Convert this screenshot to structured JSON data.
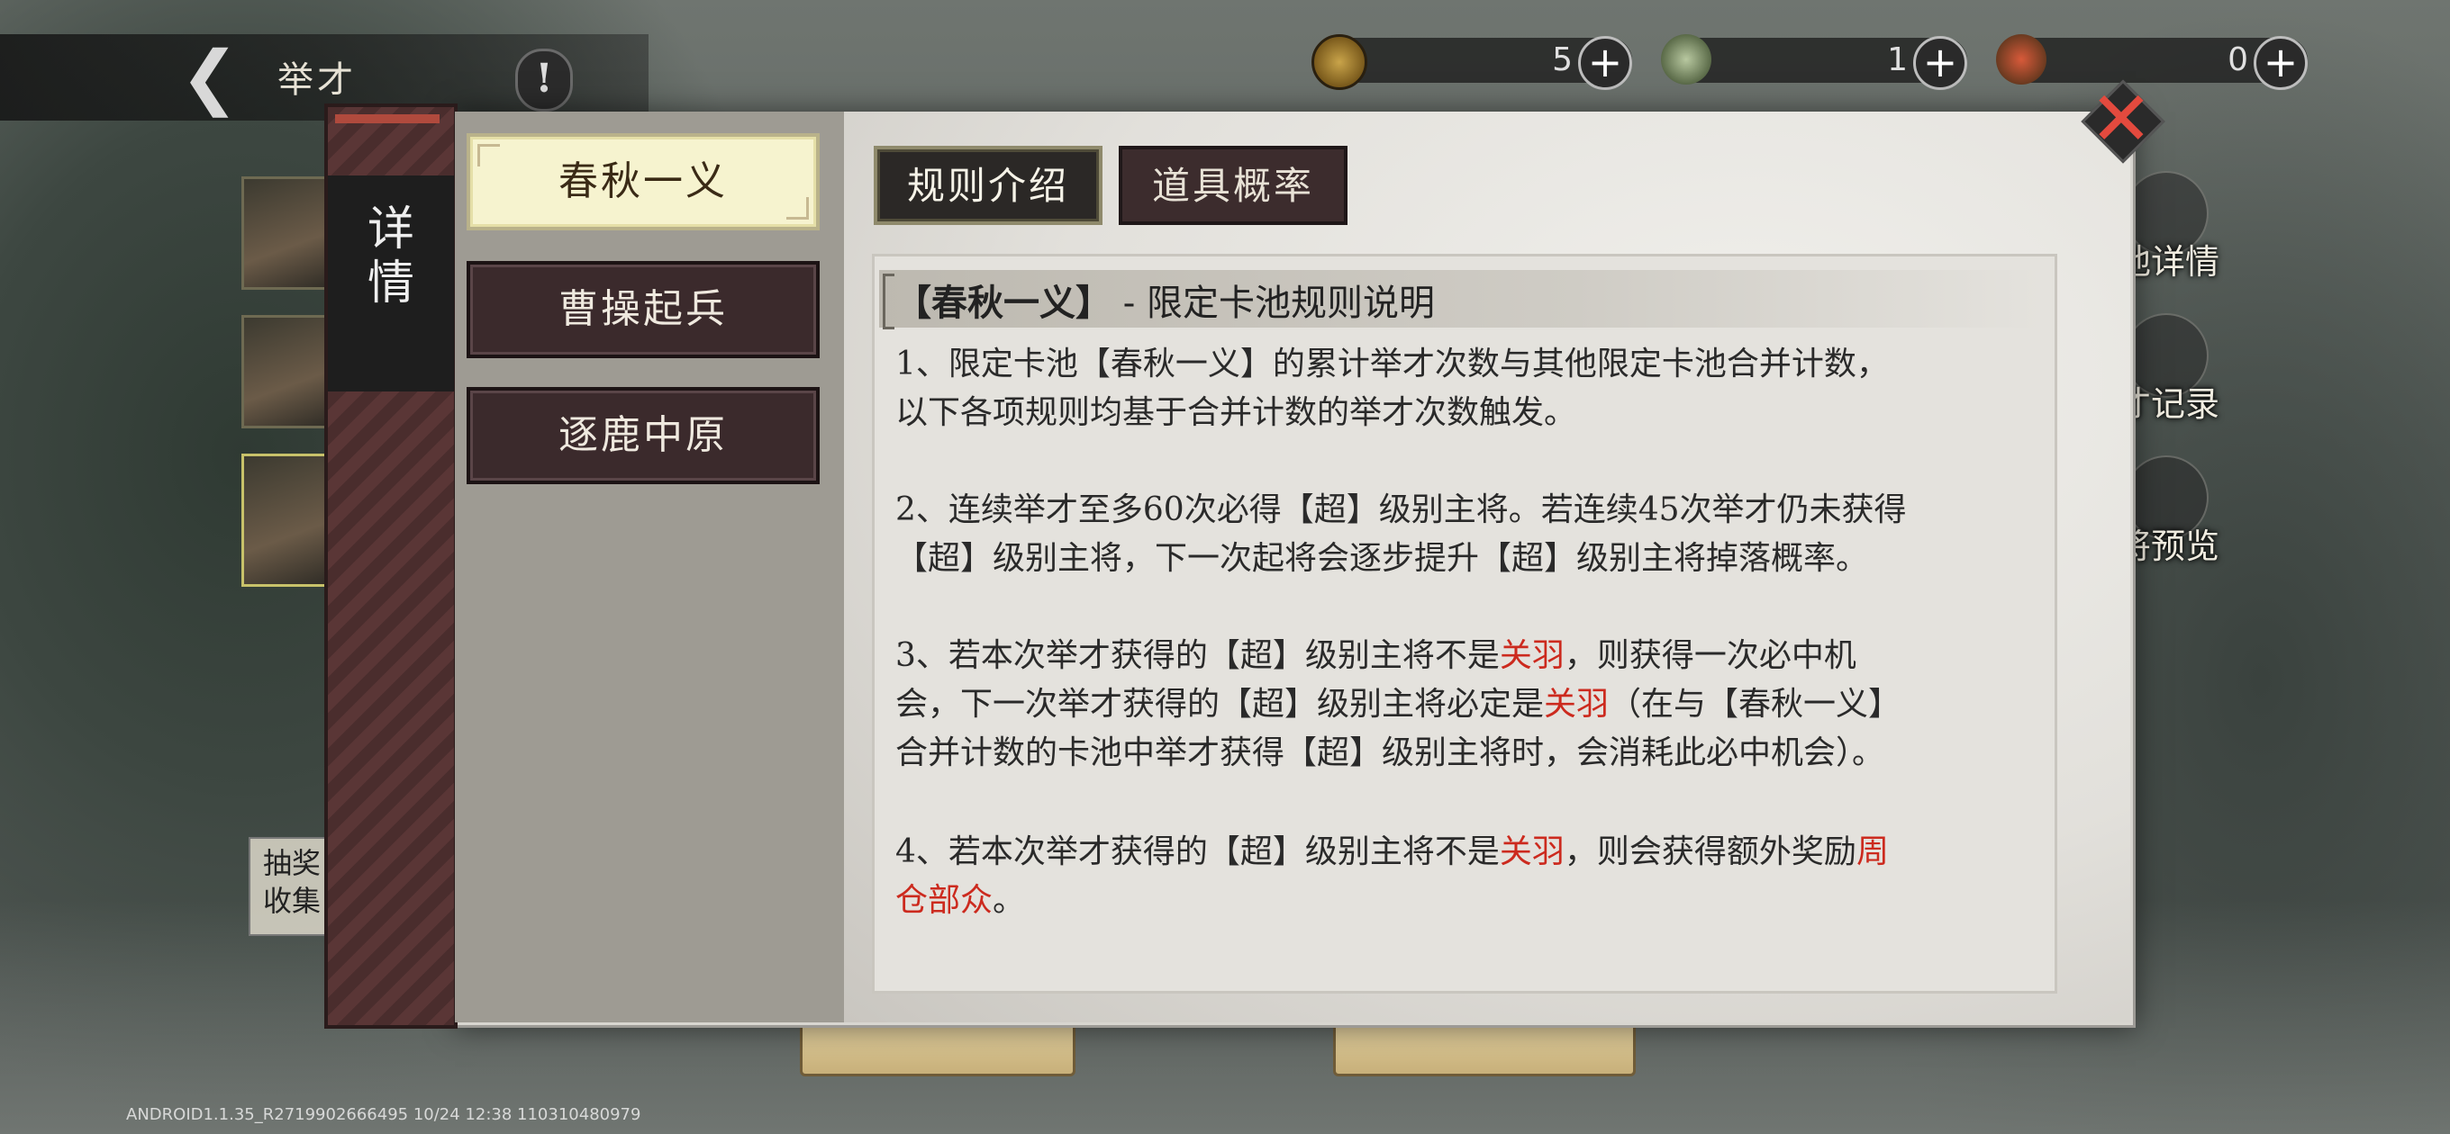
{
  "header": {
    "title": "举才",
    "info_label": "!"
  },
  "resources": [
    {
      "name": "coin",
      "icon": "coin-icon",
      "count": "5"
    },
    {
      "name": "jade",
      "icon": "jade-icon",
      "count": "1"
    },
    {
      "name": "token",
      "icon": "red-token-icon",
      "count": "0"
    }
  ],
  "right_menu": [
    {
      "label": "池详情"
    },
    {
      "label": "才记录"
    },
    {
      "label": "将预览"
    }
  ],
  "left_note": [
    "抽奖",
    "收集"
  ],
  "footer": {
    "build_info": "ANDROID1.1.35_R2719902666495 10/24 12:38 110310480979"
  },
  "dialog": {
    "vertical_tab": [
      "详",
      "情"
    ],
    "categories": [
      {
        "label": "春秋一义",
        "active": true
      },
      {
        "label": "曹操起兵",
        "active": false
      },
      {
        "label": "逐鹿中原",
        "active": false
      }
    ],
    "sub_tabs": [
      {
        "label": "规则介绍",
        "active": true
      },
      {
        "label": "道具概率",
        "active": false
      }
    ],
    "rules": {
      "title_bracket": "【春秋一义】",
      "title_rest": "- 限定卡池规则说明",
      "p1": {
        "l1": "1、限定卡池【春秋一义】的累计举才次数与其他限定卡池合并计数，",
        "l2": "以下各项规则均基于合并计数的举才次数触发。"
      },
      "p2": {
        "l1": "2、连续举才至多60次必得【超】级别主将。若连续45次举才仍未获得",
        "l2": "【超】级别主将，下一次起将会逐步提升【超】级别主将掉落概率。"
      },
      "p3": {
        "l1a": "3、若本次举才获得的【超】级别主将不是",
        "hero": "关羽",
        "l1b": "，则获得一次必中机",
        "l2a": "会，下一次举才获得的【超】级别主将必定是",
        "l2b": "（在与【春秋一义】",
        "l3": "合并计数的卡池中举才获得【超】级别主将时，会消耗此必中机会）。"
      },
      "p4": {
        "l1a": "4、若本次举才获得的【超】级别主将不是",
        "hero": "关羽",
        "l1b": "，则会获得额外奖励",
        "reward_part1": "周",
        "reward_part2": "仓部众",
        "end": "。"
      }
    }
  },
  "colors": {
    "highlight_red": "#cc2a1e",
    "tab_active_bg": "#f6f3cf",
    "tab_inactive_bg": "#3b2a2c"
  }
}
